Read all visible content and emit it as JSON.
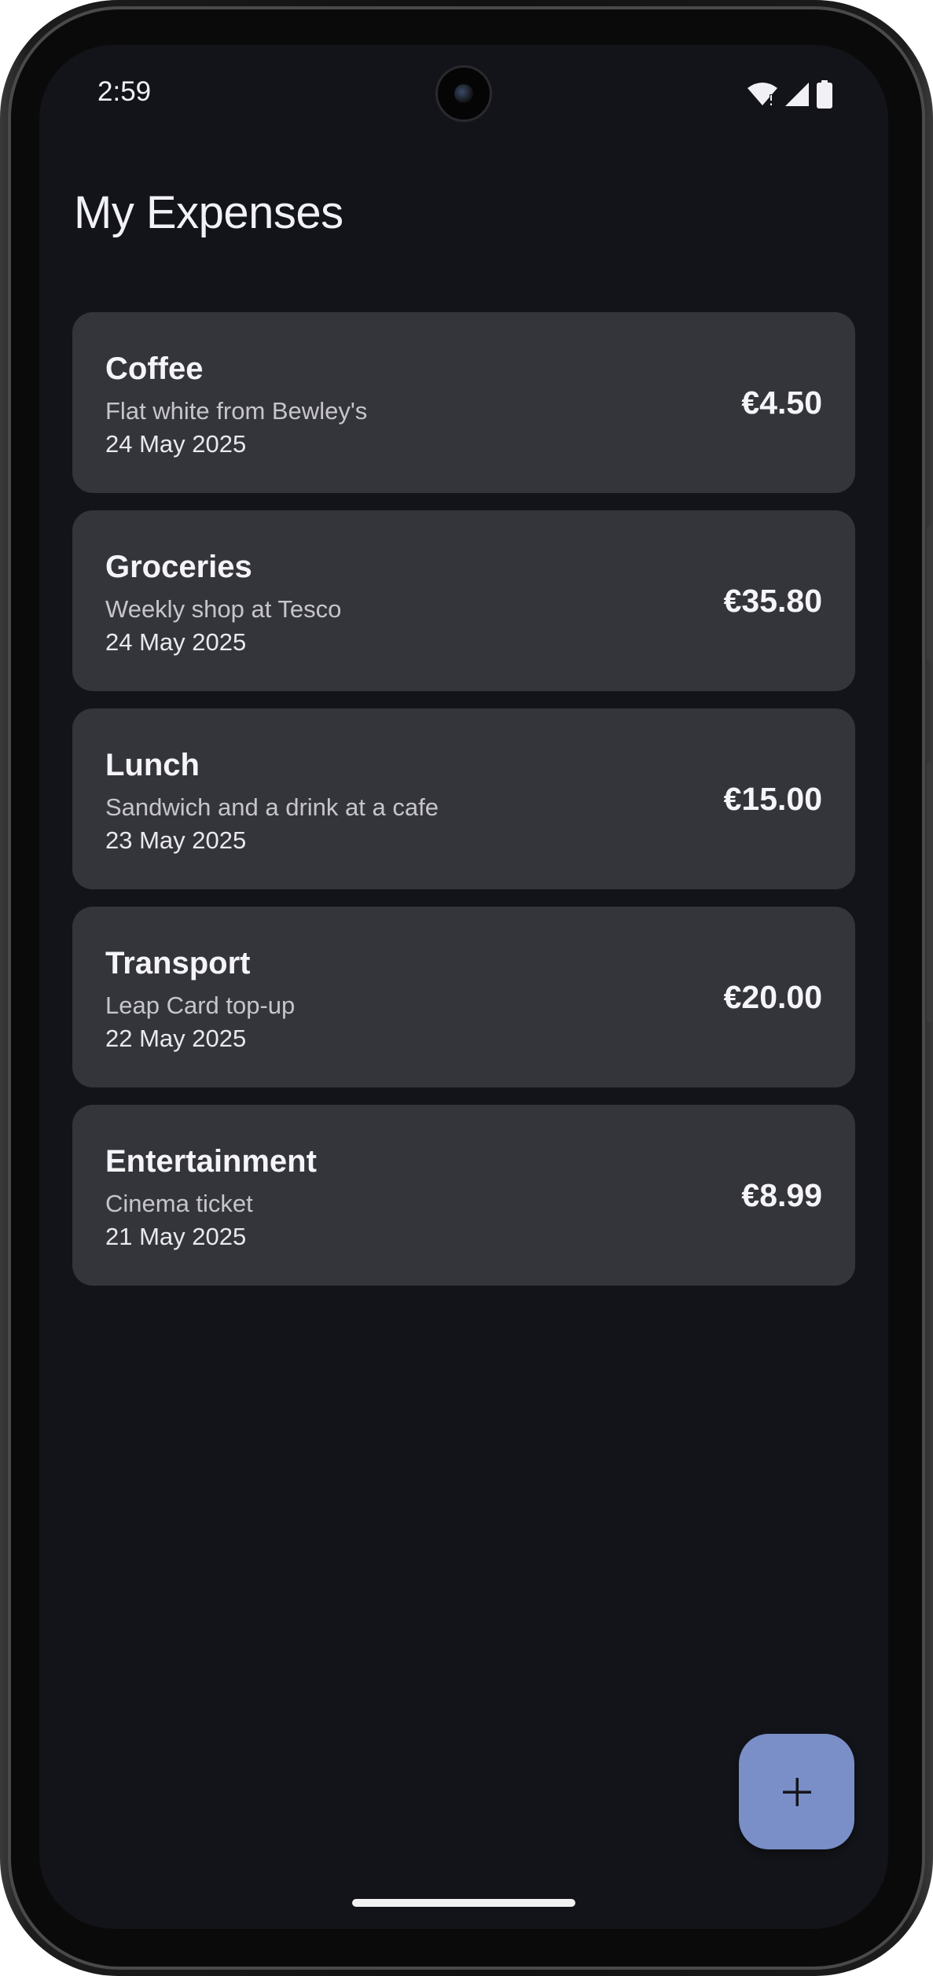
{
  "status_bar": {
    "time": "2:59",
    "icons": [
      "wifi-icon",
      "signal-icon",
      "battery-icon"
    ]
  },
  "header": {
    "title": "My Expenses"
  },
  "expenses": [
    {
      "title": "Coffee",
      "description": "Flat white from Bewley's",
      "date": "24 May 2025",
      "amount": "€4.50"
    },
    {
      "title": "Groceries",
      "description": "Weekly shop at Tesco",
      "date": "24 May 2025",
      "amount": "€35.80"
    },
    {
      "title": "Lunch",
      "description": "Sandwich and a drink at a cafe",
      "date": "23 May 2025",
      "amount": "€15.00"
    },
    {
      "title": "Transport",
      "description": "Leap Card top-up",
      "date": "22 May 2025",
      "amount": "€20.00"
    },
    {
      "title": "Entertainment",
      "description": "Cinema ticket",
      "date": "21 May 2025",
      "amount": "€8.99"
    }
  ],
  "fab": {
    "icon": "plus-icon"
  },
  "colors": {
    "background": "#131419",
    "card": "#34353a",
    "fab": "#7a8fc8"
  }
}
